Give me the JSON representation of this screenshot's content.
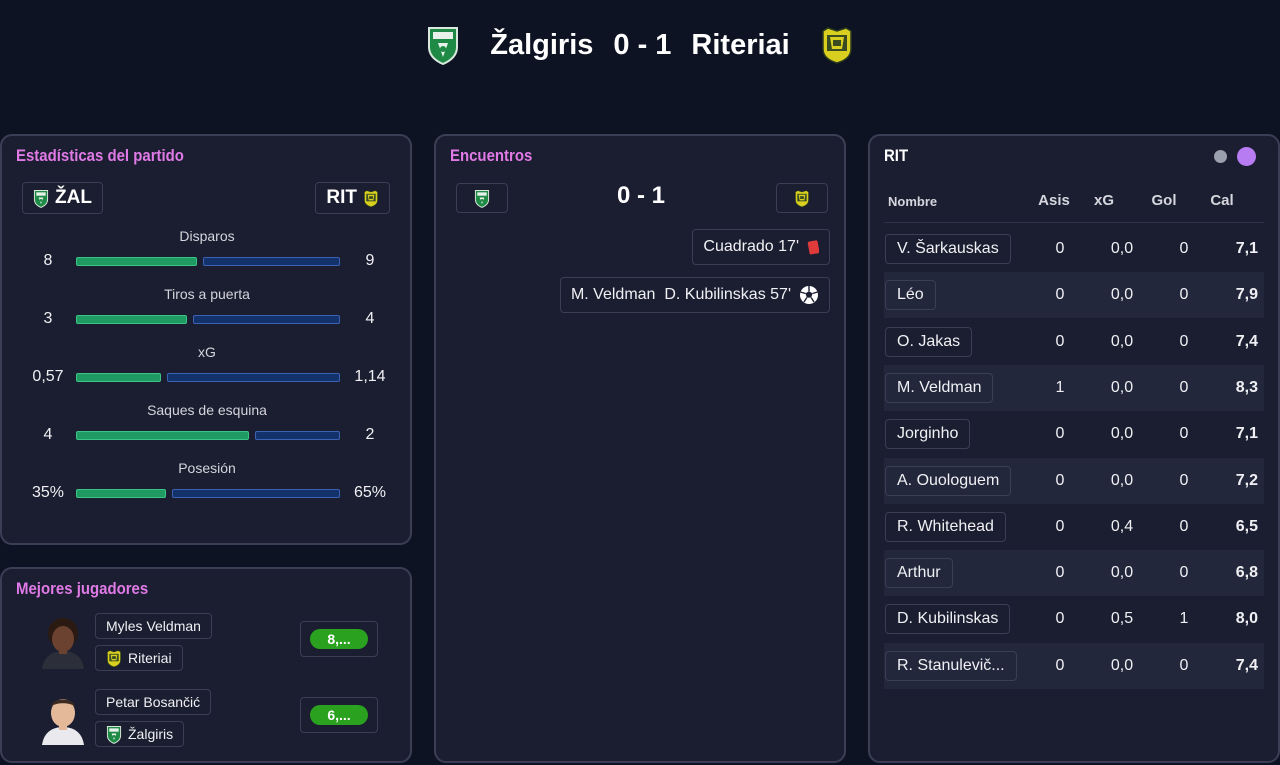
{
  "header": {
    "home_team": "Žalgiris",
    "score": "0 - 1",
    "away_team": "Riteriai",
    "home_crest": "zalgiris-crest-icon",
    "away_crest": "riteriai-crest-icon"
  },
  "colors": {
    "accent_title": "#e07ae6",
    "home_bar": "#1f9a63",
    "away_bar": "#13316a",
    "rating_pill": "#2aa21f",
    "panel_bg": "#1b1e30",
    "page_bg": "#0d1322"
  },
  "stats": {
    "title": "Estadísticas del partido",
    "home_abbr": "ŽAL",
    "away_abbr": "RIT",
    "rows": [
      {
        "label": "Disparos",
        "home": "8",
        "away": "9",
        "home_share": 0.47
      },
      {
        "label": "Tiros a puerta",
        "home": "3",
        "away": "4",
        "home_share": 0.43
      },
      {
        "label": "xG",
        "home": "0,57",
        "away": "1,14",
        "home_share": 0.33
      },
      {
        "label": "Saques de esquina",
        "home": "4",
        "away": "2",
        "home_share": 0.67
      },
      {
        "label": "Posesión",
        "home": "35%",
        "away": "65%",
        "home_share": 0.35
      }
    ]
  },
  "best_players": {
    "title": "Mejores jugadores",
    "players": [
      {
        "name": "Myles Veldman",
        "club": "Riteriai",
        "rating": "8,..."
      },
      {
        "name": "Petar Bosančić",
        "club": "Žalgiris",
        "rating": "6,..."
      }
    ]
  },
  "encounters": {
    "title": "Encuentros",
    "score": "0 - 1",
    "events": [
      {
        "text": "Cuadrado 17'",
        "icon": "red-card-icon"
      },
      {
        "text": "M. Veldman  D. Kubilinskas 57'",
        "icon": "soccer-ball-icon"
      }
    ]
  },
  "lineup": {
    "title": "RIT",
    "toggle": [
      "gray-dot-toggle",
      "purple-dot-toggle"
    ],
    "headers": {
      "name": "Nombre",
      "assists": "Asis",
      "xg": "xG",
      "goals": "Gol",
      "rating": "Cal"
    },
    "rows": [
      {
        "name": "V. Šarkauskas",
        "assists": "0",
        "xg": "0,0",
        "goals": "0",
        "rating": "7,1"
      },
      {
        "name": "Léo",
        "assists": "0",
        "xg": "0,0",
        "goals": "0",
        "rating": "7,9"
      },
      {
        "name": "O. Jakas",
        "assists": "0",
        "xg": "0,0",
        "goals": "0",
        "rating": "7,4"
      },
      {
        "name": "M. Veldman",
        "assists": "1",
        "xg": "0,0",
        "goals": "0",
        "rating": "8,3"
      },
      {
        "name": "Jorginho",
        "assists": "0",
        "xg": "0,0",
        "goals": "0",
        "rating": "7,1"
      },
      {
        "name": "A. Ouologuem",
        "assists": "0",
        "xg": "0,0",
        "goals": "0",
        "rating": "7,2"
      },
      {
        "name": "R. Whitehead",
        "assists": "0",
        "xg": "0,4",
        "goals": "0",
        "rating": "6,5"
      },
      {
        "name": "Arthur",
        "assists": "0",
        "xg": "0,0",
        "goals": "0",
        "rating": "6,8"
      },
      {
        "name": "D. Kubilinskas",
        "assists": "0",
        "xg": "0,5",
        "goals": "1",
        "rating": "8,0"
      },
      {
        "name": "R. Stanulevič...",
        "assists": "0",
        "xg": "0,0",
        "goals": "0",
        "rating": "7,4"
      }
    ]
  }
}
